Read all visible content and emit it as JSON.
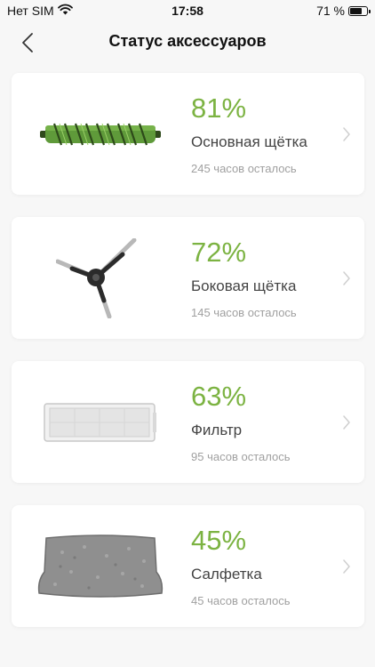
{
  "status_bar": {
    "carrier": "Нет SIM",
    "time": "17:58",
    "battery_text": "71 %",
    "battery_level": 0.71
  },
  "header": {
    "title": "Статус аксессуаров"
  },
  "colors": {
    "accent": "#7cb342",
    "background": "#f7f7f7",
    "card": "#ffffff"
  },
  "accessories": [
    {
      "icon": "main-brush-image",
      "percent": "81%",
      "name": "Основная щётка",
      "remaining": "245 часов осталось"
    },
    {
      "icon": "side-brush-image",
      "percent": "72%",
      "name": "Боковая щётка",
      "remaining": "145 часов осталось"
    },
    {
      "icon": "filter-image",
      "percent": "63%",
      "name": "Фильтр",
      "remaining": "95 часов осталось"
    },
    {
      "icon": "mop-pad-image",
      "percent": "45%",
      "name": "Салфетка",
      "remaining": "45 часов осталось"
    }
  ]
}
